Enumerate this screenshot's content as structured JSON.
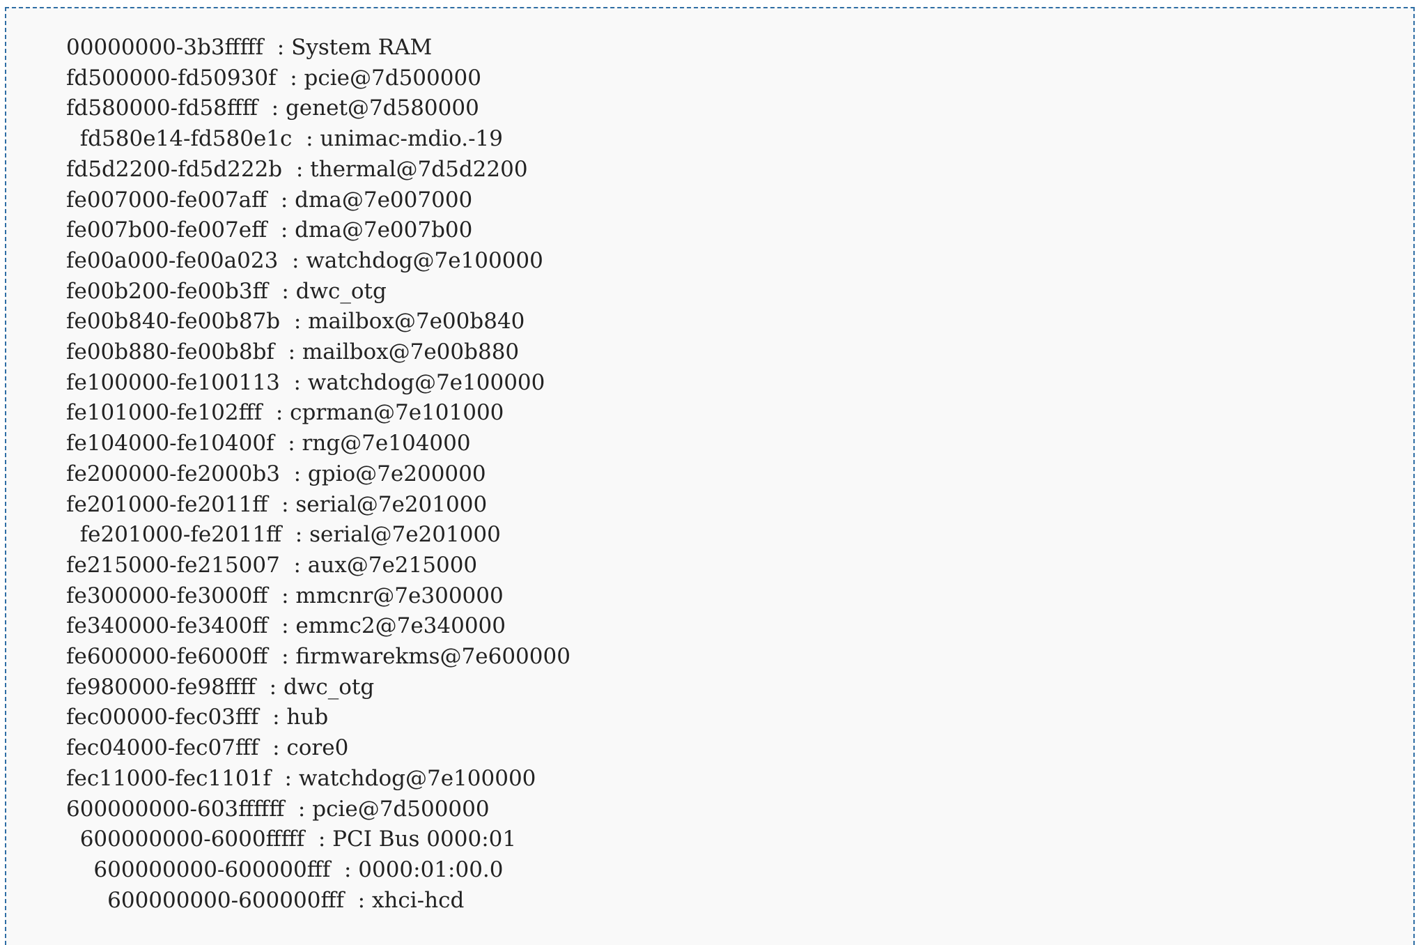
{
  "memory_map": {
    "lines": [
      "00000000-3b3fffff  : System RAM",
      "fd500000-fd50930f  : pcie@7d500000",
      "fd580000-fd58ffff  : genet@7d580000",
      "  fd580e14-fd580e1c  : unimac-mdio.-19",
      "fd5d2200-fd5d222b  : thermal@7d5d2200",
      "fe007000-fe007aff  : dma@7e007000",
      "fe007b00-fe007eff  : dma@7e007b00",
      "fe00a000-fe00a023  : watchdog@7e100000",
      "fe00b200-fe00b3ff  : dwc_otg",
      "fe00b840-fe00b87b  : mailbox@7e00b840",
      "fe00b880-fe00b8bf  : mailbox@7e00b880",
      "fe100000-fe100113  : watchdog@7e100000",
      "fe101000-fe102fff  : cprman@7e101000",
      "fe104000-fe10400f  : rng@7e104000",
      "fe200000-fe2000b3  : gpio@7e200000",
      "fe201000-fe2011ff  : serial@7e201000",
      "  fe201000-fe2011ff  : serial@7e201000",
      "fe215000-fe215007  : aux@7e215000",
      "fe300000-fe3000ff  : mmcnr@7e300000",
      "fe340000-fe3400ff  : emmc2@7e340000",
      "fe600000-fe6000ff  : firmwarekms@7e600000",
      "fe980000-fe98ffff  : dwc_otg",
      "fec00000-fec03fff  : hub",
      "fec04000-fec07fff  : core0",
      "fec11000-fec1101f  : watchdog@7e100000",
      "600000000-603ffffff  : pcie@7d500000",
      "  600000000-6000fffff  : PCI Bus 0000:01",
      "    600000000-600000fff  : 0000:01:00.0",
      "      600000000-600000fff  : xhci-hcd"
    ]
  }
}
